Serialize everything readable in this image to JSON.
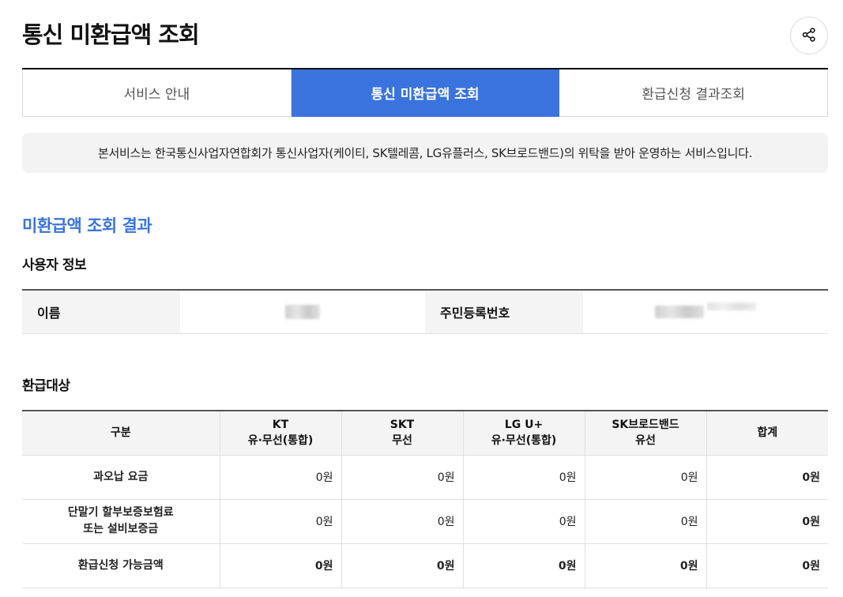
{
  "header": {
    "title": "통신 미환급액 조회",
    "share_icon": "share-icon"
  },
  "tabs": [
    {
      "label": "서비스 안내",
      "active": false
    },
    {
      "label": "통신 미환급액 조회",
      "active": true
    },
    {
      "label": "환급신청 결과조회",
      "active": false
    }
  ],
  "notice": {
    "text": "본서비스는 한국통신사업자연합회가 통신사업자(케이티, SK텔레콤, LG유플러스, SK브로드밴드)의 위탁을 받아 운영하는 서비스입니다."
  },
  "result": {
    "title": "미환급액 조회 결과",
    "user_info": {
      "title": "사용자 정보",
      "name_label": "이름",
      "rrn_label": "주민등록번호"
    },
    "refund": {
      "title": "환급대상",
      "headers": [
        "구분",
        "KT\n유·무선(통합)",
        "SKT\n무선",
        "LG U+\n유·무선(통합)",
        "SK브로드밴드\n유선",
        "합계"
      ],
      "rows": [
        {
          "label": "과오납 요금",
          "values": [
            "0원",
            "0원",
            "0원",
            "0원",
            "0원"
          ]
        },
        {
          "label": "단말기 할부보증보험료\n또는 설비보증금",
          "values": [
            "0원",
            "0원",
            "0원",
            "0원",
            "0원"
          ]
        },
        {
          "label": "환급신청 가능금액",
          "values": [
            "0원",
            "0원",
            "0원",
            "0원",
            "0원"
          ]
        }
      ]
    }
  },
  "colors": {
    "accent": "#3a73dd",
    "notice_bg": "#f3f3f3",
    "label_bg": "#f4f4f4"
  }
}
